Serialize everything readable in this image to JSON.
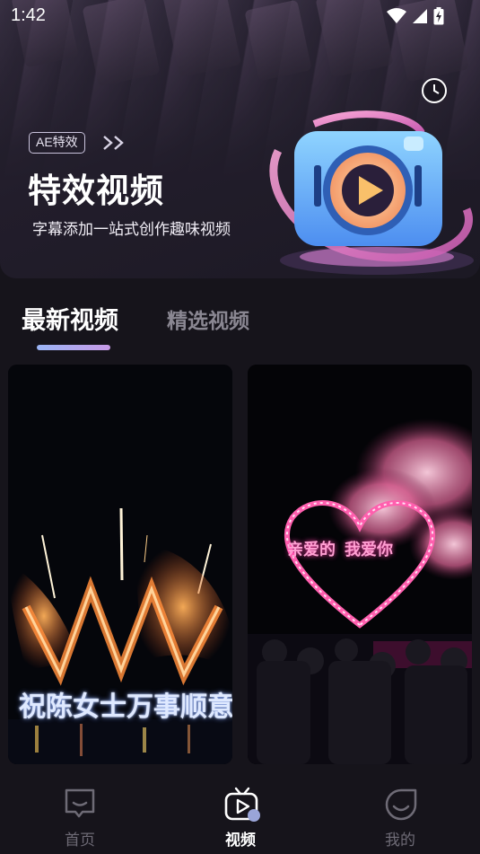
{
  "status_bar": {
    "time": "1:42"
  },
  "banner": {
    "tag": "AE特效",
    "title": "特效视频",
    "subtitle": "字幕添加一站式创作趣味视频"
  },
  "tabs": [
    {
      "label": "最新视频",
      "active": true
    },
    {
      "label": "精选视频",
      "active": false
    }
  ],
  "videos": [
    {
      "caption": "祝陈女士万事顺意"
    },
    {
      "caption_left": "亲爱的",
      "caption_right": "我爱你"
    }
  ],
  "bottom_nav": [
    {
      "label": "首页",
      "icon": "chat-bubble-icon",
      "active": false
    },
    {
      "label": "视频",
      "icon": "tv-play-icon",
      "active": true
    },
    {
      "label": "我的",
      "icon": "smile-face-icon",
      "active": false
    }
  ],
  "colors": {
    "background": "#16141b",
    "active_text": "#ffffff",
    "inactive_text": "#8a8792",
    "tab_indicator_start": "#9ab5f5",
    "tab_indicator_end": "#c79ae6"
  }
}
